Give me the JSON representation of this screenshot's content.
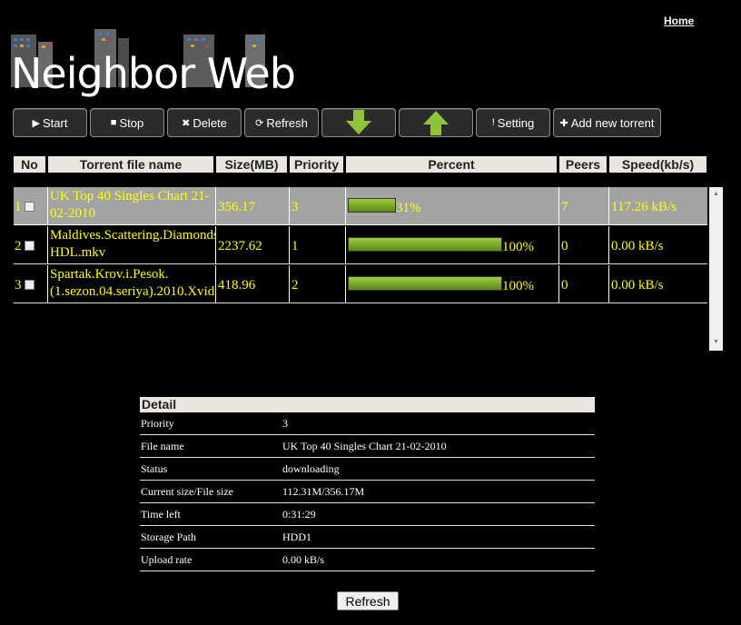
{
  "header": {
    "home_link": "Home",
    "logo_text": "Neighbor Web"
  },
  "toolbar": {
    "start": "Start",
    "stop": "Stop",
    "delete": "Delete",
    "refresh": "Refresh",
    "setting": "Setting",
    "add": "Add new torrent",
    "icons": [
      "play-icon",
      "stop-icon",
      "delete-icon",
      "refresh-icon",
      "arrow-down-icon",
      "arrow-up-icon",
      "setting-icon",
      "plus-icon"
    ],
    "accent_color": "#8fc43a"
  },
  "table": {
    "columns": [
      "No",
      "Torrent file name",
      "Size(MB)",
      "Priority",
      "Percent",
      "Peers",
      "Speed(kb/s)"
    ],
    "rows": [
      {
        "no": "1",
        "name": "UK Top 40 Singles Chart 21-02-2010",
        "size": "356.17",
        "priority": "3",
        "percent": "31%",
        "progress": 31,
        "peers": "7",
        "speed": "117.26 kB/s",
        "selected": true
      },
      {
        "no": "2",
        "name": "Maldives.Scattering.Diamonds HDL.mkv",
        "size": "2237.62",
        "priority": "1",
        "percent": "100%",
        "progress": 100,
        "peers": "0",
        "speed": "0.00 kB/s",
        "selected": false
      },
      {
        "no": "3",
        "name": "Spartak.Krov.i.Pesok.(1.sezon.04.seriya).2010.Xvid",
        "size": "418.96",
        "priority": "2",
        "percent": "100%",
        "progress": 100,
        "peers": "0",
        "speed": "0.00 kB/s",
        "selected": false
      }
    ]
  },
  "detail": {
    "title": "Detail",
    "rows": [
      {
        "key": "Priority",
        "value": "3"
      },
      {
        "key": "File name",
        "value": "UK Top 40 Singles Chart 21-02-2010"
      },
      {
        "key": "Status",
        "value": "downloading"
      },
      {
        "key": "Current size/File size",
        "value": "112.31M/356.17M"
      },
      {
        "key": "Time left",
        "value": "0:31:29"
      },
      {
        "key": "Storage Path",
        "value": "HDD1"
      },
      {
        "key": "Upload rate",
        "value": "0.00 kB/s"
      }
    ],
    "refresh_label": "Refresh"
  }
}
